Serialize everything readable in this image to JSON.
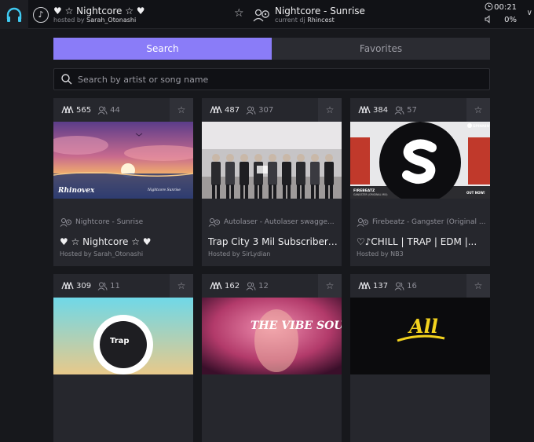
{
  "topbar": {
    "room_name": "♥ ☆ Nightcore ☆ ♥",
    "room_host_prefix": "hosted by",
    "room_host_name": "Sarah_Otonashi",
    "now_playing": "Nightcore - Sunrise",
    "dj_prefix": "current dj",
    "dj_name": "Rhincest",
    "time": "00:21",
    "volume": "0%"
  },
  "tabs": [
    {
      "label": "Search",
      "active": true
    },
    {
      "label": "Favorites",
      "active": false
    }
  ],
  "search": {
    "placeholder": "Search by artist or song name"
  },
  "rooms": [
    {
      "popularity": "565",
      "users": "44",
      "song": "Nightcore - Sunrise",
      "title": "♥ ☆ Nightcore ☆ ♥",
      "host": "Hosted by Sarah_Otonashi",
      "thumb": "sunset",
      "thumb_text": "Rhinovex",
      "thumb_text_small": "Nightcore Sunrise"
    },
    {
      "popularity": "487",
      "users": "307",
      "song": "Autolaser - Autolaser swagge...",
      "title": "Trap City 3 Mil Subscriber ...",
      "host": "Hosted by SirLydian",
      "thumb": "band"
    },
    {
      "popularity": "384",
      "users": "57",
      "song": "Firebeatz - Gangster (Original ...",
      "title": "♡♪CHILL | TRAP | EDM |...",
      "host": "Hosted by NB3",
      "thumb": "spinnin",
      "thumb_text": "FIREBEATZ",
      "thumb_text_small": "GANGSTER (ORIGINAL MIX)",
      "thumb_text_right": "OUT NOW!",
      "thumb_text_top": "SPINNIN'"
    },
    {
      "popularity": "309",
      "users": "11",
      "thumb": "trap-nation"
    },
    {
      "popularity": "162",
      "users": "12",
      "thumb": "vibe",
      "thumb_text": "THE VIBE SOUND"
    },
    {
      "popularity": "137",
      "users": "16",
      "thumb": "all",
      "thumb_text": "All"
    }
  ],
  "colors": {
    "accent": "#8a7cf8",
    "background": "#17181c",
    "card": "#26272d"
  }
}
